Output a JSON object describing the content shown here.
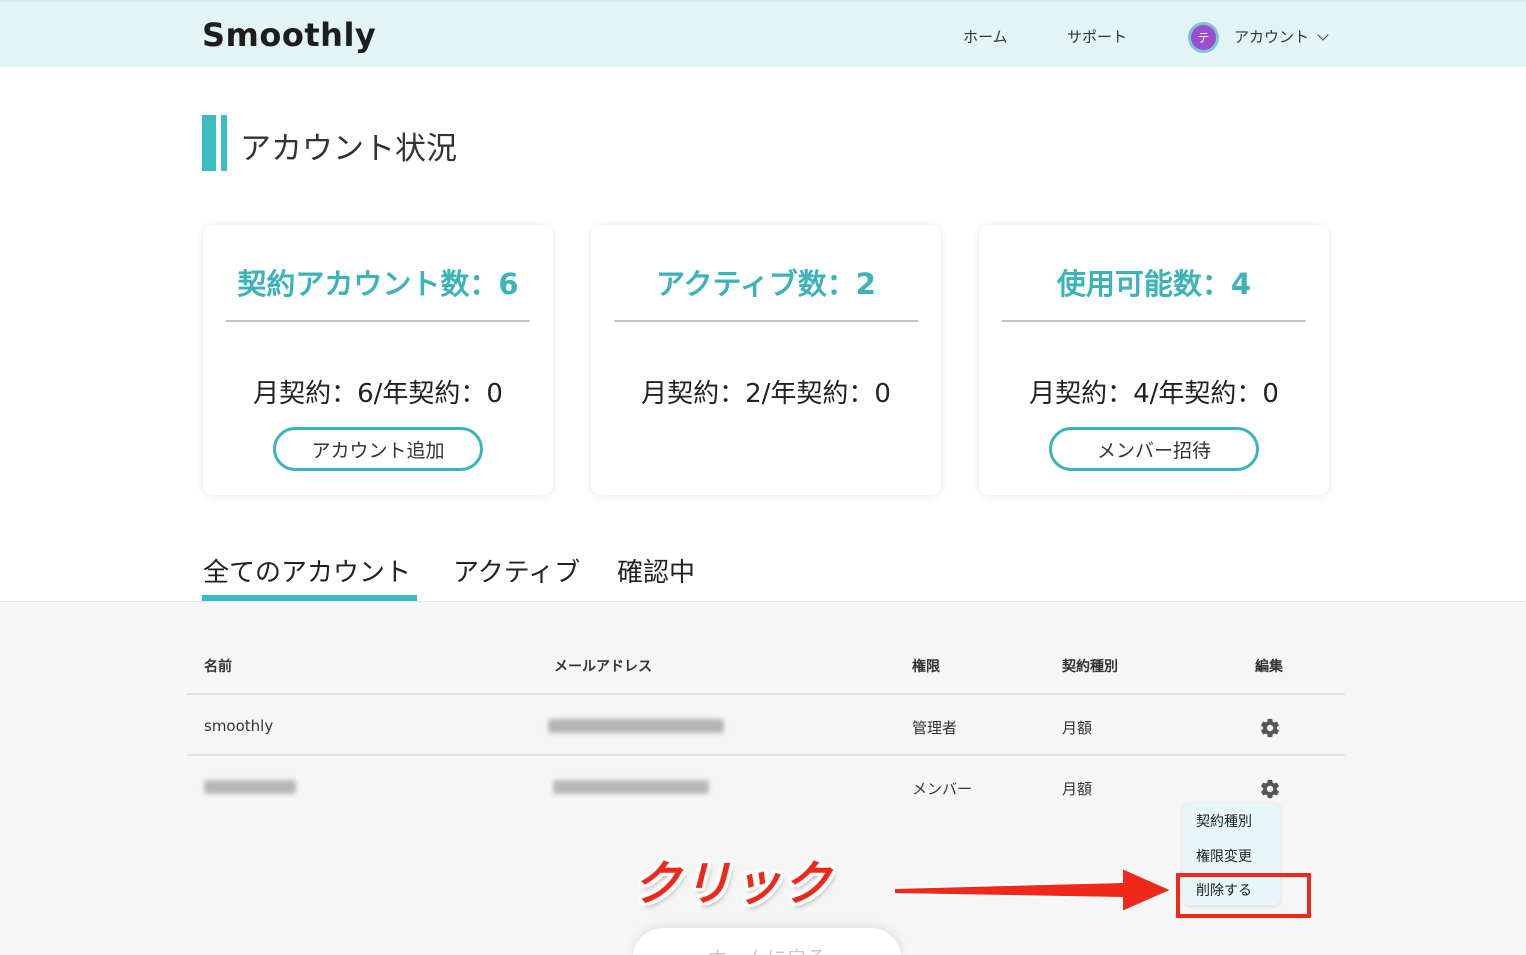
{
  "header": {
    "logo": "Smoothly",
    "nav": {
      "home": "ホーム",
      "support": "サポート"
    },
    "avatar_initial": "テ",
    "account_label": "アカウント"
  },
  "page_title": "アカウント状況",
  "cards": [
    {
      "title": "契約アカウント数：6",
      "sub": "月契約：6/年契約：0",
      "button": "アカウント追加"
    },
    {
      "title": "アクティブ数：2",
      "sub": "月契約：2/年契約：0"
    },
    {
      "title": "使用可能数：4",
      "sub": "月契約：4/年契約：0",
      "button": "メンバー招待"
    }
  ],
  "tabs": [
    "全てのアカウント",
    "アクティブ",
    "確認中"
  ],
  "active_tab": "全てのアカウント",
  "table": {
    "headers": [
      "名前",
      "メールアドレス",
      "権限",
      "契約種別",
      "編集"
    ],
    "rows": [
      {
        "name": "smoothly",
        "role": "管理者",
        "contract": "月額"
      },
      {
        "name": "",
        "role": "メンバー",
        "contract": "月額"
      }
    ]
  },
  "context_menu": [
    "契約種別",
    "権限変更",
    "削除する"
  ],
  "annotation": "クリック",
  "back_button": "ホームに戻る",
  "colors": {
    "accent": "#3bbdc0",
    "header_bg": "#e3f4f4",
    "annotation": "#f0281a"
  }
}
